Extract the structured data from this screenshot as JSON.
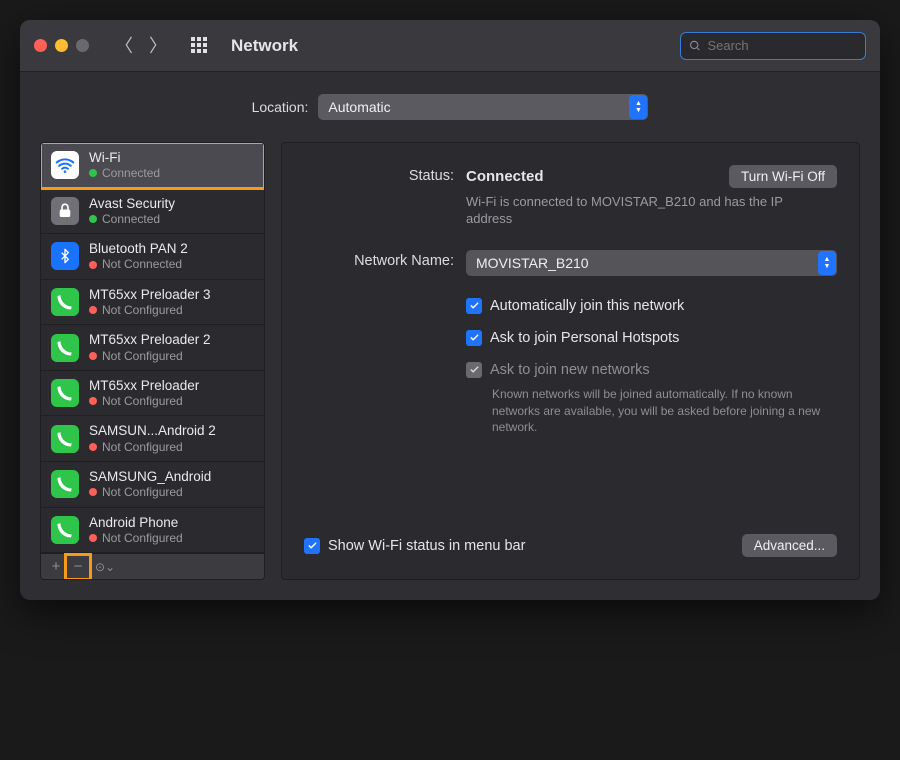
{
  "titlebar": {
    "title": "Network",
    "search_placeholder": "Search"
  },
  "location": {
    "label": "Location:",
    "selected": "Automatic"
  },
  "sidebar": {
    "items": [
      {
        "name": "Wi-Fi",
        "status": "Connected",
        "icon": "wifi",
        "dot": "green",
        "selected": true
      },
      {
        "name": "Avast Security",
        "status": "Connected",
        "icon": "lock",
        "dot": "green"
      },
      {
        "name": "Bluetooth PAN 2",
        "status": "Not Connected",
        "icon": "bt",
        "dot": "red"
      },
      {
        "name": "MT65xx Preloader 3",
        "status": "Not Configured",
        "icon": "phone",
        "dot": "red"
      },
      {
        "name": "MT65xx Preloader 2",
        "status": "Not Configured",
        "icon": "phone",
        "dot": "red"
      },
      {
        "name": "MT65xx Preloader",
        "status": "Not Configured",
        "icon": "phone",
        "dot": "red"
      },
      {
        "name": "SAMSUN...Android 2",
        "status": "Not Configured",
        "icon": "phone",
        "dot": "red"
      },
      {
        "name": "SAMSUNG_Android",
        "status": "Not Configured",
        "icon": "phone",
        "dot": "red"
      },
      {
        "name": "Android Phone",
        "status": "Not Configured",
        "icon": "phone",
        "dot": "red"
      }
    ]
  },
  "detail": {
    "status_label": "Status:",
    "status_value": "Connected",
    "turn_off_btn": "Turn Wi-Fi Off",
    "status_desc": "Wi-Fi is connected to MOVISTAR_B210 and has the IP address",
    "net_label": "Network Name:",
    "net_value": "MOVISTAR_B210",
    "cb_auto_join": "Automatically join this network",
    "cb_hotspot": "Ask to join Personal Hotspots",
    "cb_new_nets": "Ask to join new networks",
    "cb_new_desc": "Known networks will be joined automatically. If no known networks are available, you will be asked before joining a new network.",
    "cb_menubar": "Show Wi-Fi status in menu bar",
    "advanced_btn": "Advanced..."
  }
}
